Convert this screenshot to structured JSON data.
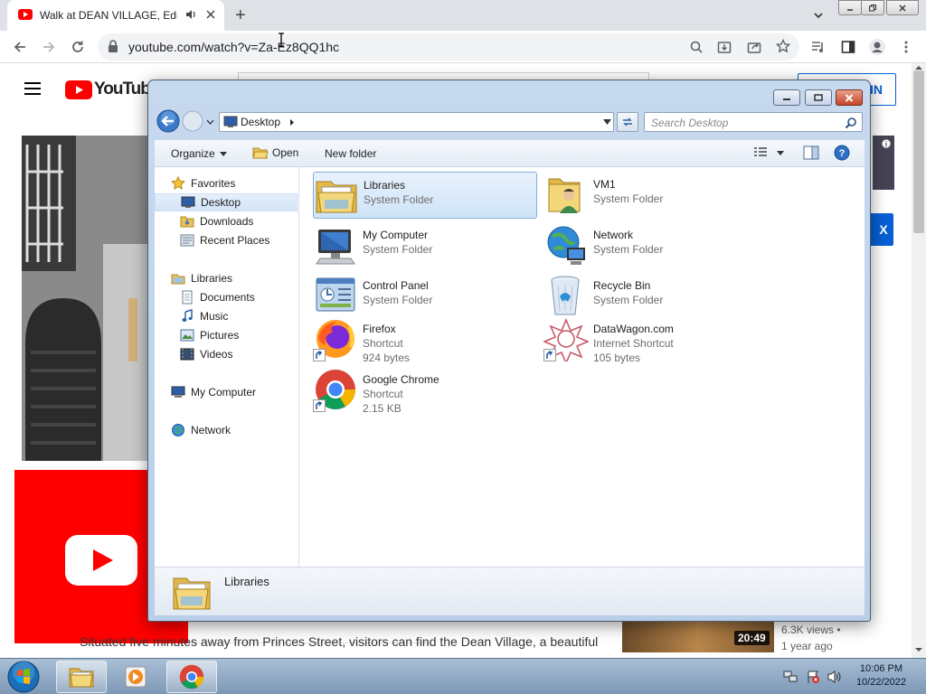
{
  "browser": {
    "tab_title": "Walk at DEAN VILLAGE, Edin",
    "url": "youtube.com/watch?v=Za-Ez8QQ1hc",
    "new_tab_label": "+"
  },
  "youtube": {
    "logo_text": "YouTube",
    "sign_in_label": "IN",
    "right_button_label": "X",
    "description": "Situated five minutes away from Princes Street, visitors can find the Dean Village, a beautiful",
    "rec_duration": "20:49",
    "rec_views": "6.3K views •",
    "rec_age": "1 year ago"
  },
  "explorer": {
    "breadcrumb": "Desktop",
    "search_placeholder": "Search Desktop",
    "commands": {
      "organize": "Organize",
      "open": "Open",
      "new_folder": "New folder"
    },
    "nav": {
      "favorites_header": "Favorites",
      "favorites": [
        "Desktop",
        "Downloads",
        "Recent Places"
      ],
      "libraries_header": "Libraries",
      "libraries": [
        "Documents",
        "Music",
        "Pictures",
        "Videos"
      ],
      "computer": "My Computer",
      "network": "Network"
    },
    "items": [
      {
        "name": "Libraries",
        "type": "System Folder",
        "size": ""
      },
      {
        "name": "VM1",
        "type": "System Folder",
        "size": ""
      },
      {
        "name": "My Computer",
        "type": "System Folder",
        "size": ""
      },
      {
        "name": "Network",
        "type": "System Folder",
        "size": ""
      },
      {
        "name": "Control Panel",
        "type": "System Folder",
        "size": ""
      },
      {
        "name": "Recycle Bin",
        "type": "System Folder",
        "size": ""
      },
      {
        "name": "Firefox",
        "type": "Shortcut",
        "size": "924 bytes"
      },
      {
        "name": "DataWagon.com",
        "type": "Internet Shortcut",
        "size": "105 bytes"
      },
      {
        "name": "Google Chrome",
        "type": "Shortcut",
        "size": "2.15 KB"
      }
    ],
    "details_name": "Libraries"
  },
  "taskbar": {
    "time": "10:06 PM",
    "date": "10/22/2022"
  },
  "colors": {
    "yt_red": "#ff0000",
    "selection": "#cfe3f8",
    "taskbar": "#7d98b6"
  }
}
